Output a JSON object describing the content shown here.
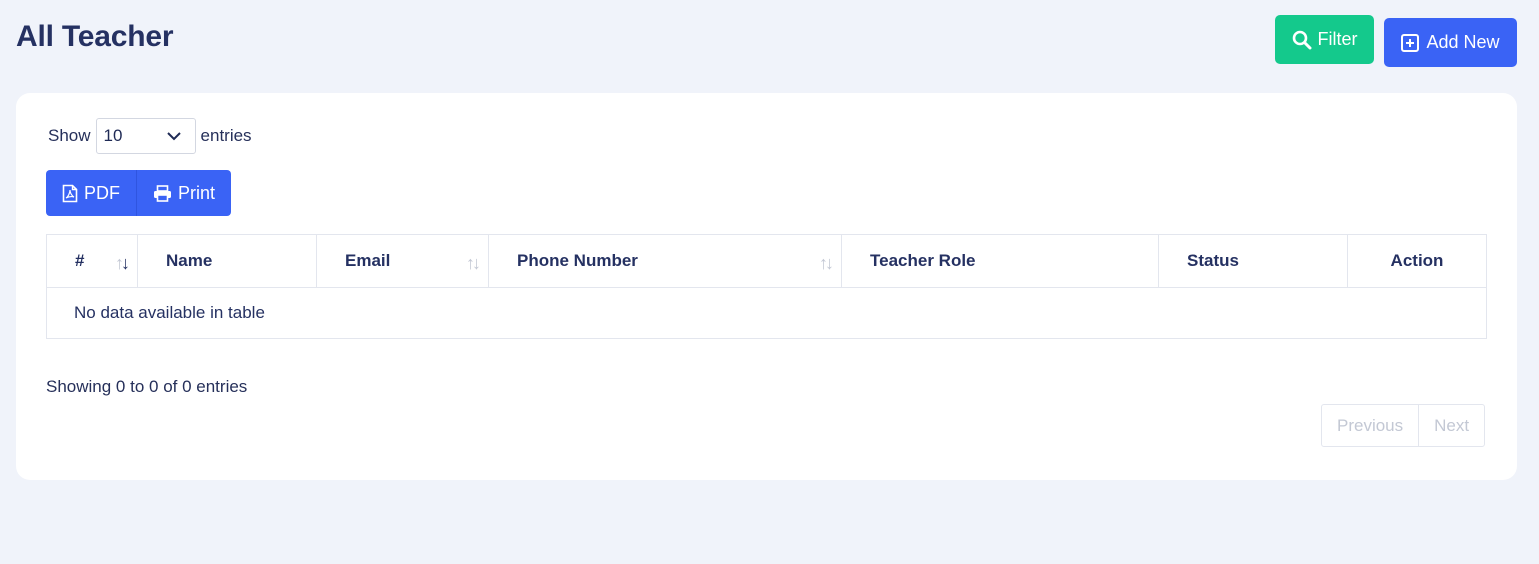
{
  "header": {
    "title": "All Teacher"
  },
  "actions": {
    "filter_label": "Filter",
    "add_label": "Add New"
  },
  "colors": {
    "filter": "#14c98c",
    "primary": "#3a63f5",
    "background": "#f0f3fa",
    "title": "#253162"
  },
  "length": {
    "show": "Show",
    "value": "10",
    "entries": "entries"
  },
  "export": {
    "pdf": "PDF",
    "print": "Print"
  },
  "table": {
    "columns": [
      "#",
      "Name",
      "Email",
      "Phone Number",
      "Teacher Role",
      "Status",
      "Action"
    ],
    "empty": "No data available in table"
  },
  "footer": {
    "info": "Showing 0 to 0 of 0 entries",
    "previous": "Previous",
    "next": "Next"
  },
  "icons": [
    "search-icon",
    "plus-square-icon",
    "chevron-down-icon",
    "pdf-file-icon",
    "printer-icon",
    "sort-icon"
  ]
}
